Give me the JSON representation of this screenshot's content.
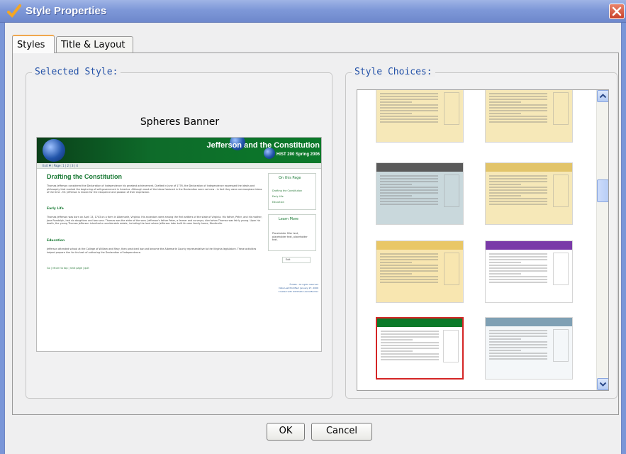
{
  "window": {
    "title": "Style Properties"
  },
  "tabs": [
    {
      "label": "Styles",
      "active": true
    },
    {
      "label": "Title & Layout",
      "active": false
    }
  ],
  "selected_style": {
    "group_label": "Selected Style:",
    "name": "Spheres Banner",
    "preview": {
      "banner_title": "Jefferson and the Constitution",
      "banner_subtitle": "HIST 200 Spring 2006",
      "nav": "Exit     ▼ | Page: 1 | 2 | 3 | 4",
      "heading": "Drafting the Constitution",
      "paragraph1": "Thomas Jefferson considered the Declaration of Independence his greatest achievement. Drafted in June of 1776, the Declaration of Independence expressed the ideals and philosophy that marked the beginning of self-government in America. Although most of the ideas featured in the Declaration were not new - in fact they were commonplace ideas of the time - Mr. Jefferson is known for the eloquence and passion of their expression.",
      "subhead1": "Early Life",
      "paragraph2": "Thomas Jefferson was born on April 13, 1743 on a farm in Albemarle, Virginia. His ancestors were among the first settlers of the state of Virginia. His father, Peter, and his mother, Jane Randolph, had six daughters and two sons. Thomas was the elder of the sons. Jefferson's father Peter, a farmer and surveyor, died when Thomas was fairly young. Upon his death, the young Thomas Jefferson inherited a considerable estate, including the land where Jefferson later built his own family home, Monticello.",
      "subhead2": "Education",
      "paragraph3": "Jefferson attended school at the College of William and Mary, then practiced law and became the Albemarle County representative to the Virginia legislature. These activities helped prepare him for his task of authoring the Declaration of Independence.",
      "footer_link": "Go | return to top | next page | quit",
      "on_this_page": "On this Page",
      "on_this_page_links": [
        "Drafting the Constitution",
        "Early Life",
        "Education"
      ],
      "learn_more": "Learn More",
      "learn_more_text": "Placeholder filler text, placeholder text, placeholder text.",
      "exit_label": "Exit",
      "footer_lines": [
        "©2006 - All rights reserved",
        "Date Last Modified: January 27, 2006",
        "Created with SoftChalk LessonBuilder"
      ]
    }
  },
  "style_choices": {
    "group_label": "Style Choices:",
    "selected_index": 6,
    "thumbs": [
      {
        "name": "parchment-a",
        "band": "#8a6a2e",
        "bg": "#f6e8b8"
      },
      {
        "name": "parchment-b",
        "band": "#8a6a2e",
        "bg": "#f6e8b8"
      },
      {
        "name": "slate",
        "band": "#5a5a5a",
        "bg": "#c9d8dc"
      },
      {
        "name": "sand",
        "band": "#e2c46a",
        "bg": "#f6e8b8"
      },
      {
        "name": "sunburst",
        "band": "#e9c766",
        "bg": "#f8e6b0"
      },
      {
        "name": "violet",
        "band": "#7a3aa8",
        "bg": "#ffffff"
      },
      {
        "name": "spheres-banner",
        "band": "#0b7a2a",
        "bg": "#ffffff"
      },
      {
        "name": "mosaic",
        "band": "#7fa0b4",
        "bg": "#f4f7f9"
      }
    ]
  },
  "buttons": {
    "ok": "OK",
    "cancel": "Cancel"
  }
}
